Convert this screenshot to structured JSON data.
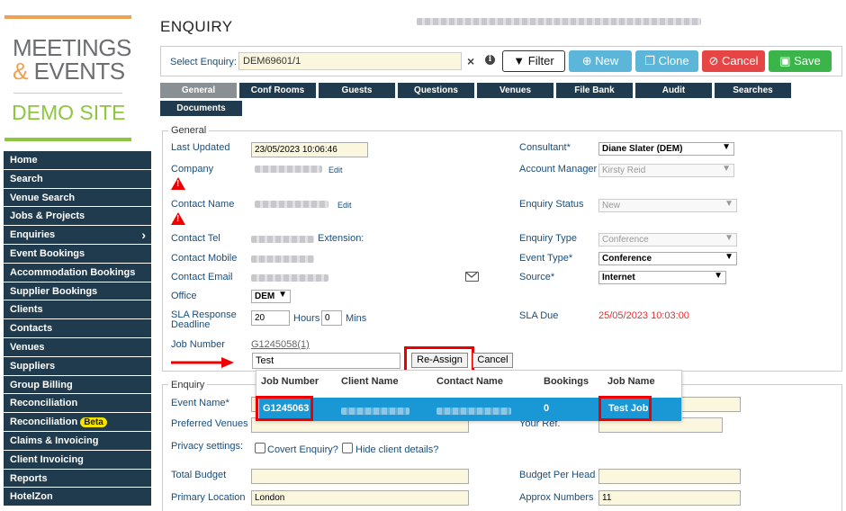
{
  "logo": {
    "line1": "MEETINGS",
    "amp": "&",
    "line2": "EVENTS",
    "demo": "DEMO SITE"
  },
  "sidebar": {
    "items": [
      {
        "label": "Home"
      },
      {
        "label": "Search"
      },
      {
        "label": "Venue Search"
      },
      {
        "label": "Jobs & Projects"
      },
      {
        "label": "Enquiries"
      },
      {
        "label": "Event Bookings"
      },
      {
        "label": "Accommodation Bookings"
      },
      {
        "label": "Supplier Bookings"
      },
      {
        "label": "Clients"
      },
      {
        "label": "Contacts"
      },
      {
        "label": "Venues"
      },
      {
        "label": "Suppliers"
      },
      {
        "label": "Group Billing"
      },
      {
        "label": "Reconciliation"
      },
      {
        "label": "Reconciliation",
        "badge": "Beta"
      },
      {
        "label": "Claims & Invoicing"
      },
      {
        "label": "Client Invoicing"
      },
      {
        "label": "Reports"
      },
      {
        "label": "HotelZon"
      }
    ]
  },
  "page": {
    "title": "ENQUIRY"
  },
  "select_bar": {
    "label": "Select Enquiry:",
    "value": "DEM69601/1",
    "clear": "×",
    "info": "i"
  },
  "buttons": {
    "filter": "Filter",
    "new": "New",
    "clone": "Clone",
    "cancel": "Cancel",
    "save": "Save"
  },
  "tabs": [
    "General",
    "Conf Rooms",
    "Guests",
    "Questions",
    "Venues",
    "File Bank",
    "Audit",
    "Searches",
    "Documents"
  ],
  "general": {
    "legend": "General",
    "last_updated_label": "Last Updated",
    "last_updated": "23/05/2023 10:06:46",
    "company_label": "Company",
    "edit": "Edit",
    "contact_name_label": "Contact Name",
    "contact_tel_label": "Contact Tel",
    "extension_label": "Extension:",
    "contact_mobile_label": "Contact Mobile",
    "contact_email_label": "Contact Email",
    "office_label": "Office",
    "office": "DEM",
    "sla_label_1": "SLA Response",
    "sla_label_2": "Deadline",
    "sla_hours": "20",
    "hours_label": "Hours",
    "sla_mins": "0",
    "mins_label": "Mins",
    "job_number_label": "Job Number",
    "job_number_link": "G1245058(1)",
    "job_search": "Test",
    "reassign": "Re-Assign",
    "cancel": "Cancel",
    "consultant_label": "Consultant*",
    "consultant": "Diane Slater (DEM)",
    "account_manager_label": "Account Manager",
    "account_manager": "Kirsty Reid",
    "enquiry_status_label": "Enquiry Status",
    "enquiry_status": "New",
    "enquiry_type_label": "Enquiry Type",
    "enquiry_type": "Conference",
    "event_type_label": "Event Type*",
    "event_type": "Conference",
    "source_label": "Source*",
    "source": "Internet",
    "sla_due_label": "SLA Due",
    "sla_due": "25/05/2023 10:03:00"
  },
  "popup": {
    "headers": [
      "Job Number",
      "Client Name",
      "Contact Name",
      "Bookings",
      "Job Name"
    ],
    "row": {
      "job_number": "G1245063",
      "bookings": "0",
      "job_name": "Test Job"
    }
  },
  "enquiry": {
    "legend": "Enquiry",
    "event_name_label": "Event Name*",
    "preferred_venues_label": "Preferred Venues",
    "your_ref_label": "Your Ref.",
    "privacy_label": "Privacy settings:",
    "covert_label": "Covert Enquiry?",
    "hide_label": "Hide client details?",
    "total_budget_label": "Total Budget",
    "budget_pp_label": "Budget Per Head",
    "primary_location_label": "Primary Location",
    "primary_location": "London",
    "approx_numbers_label": "Approx Numbers",
    "approx_numbers": "11"
  },
  "colors": {
    "sidebar": "#1f3b4d",
    "new": "#5bb6d9",
    "clone": "#5bb6d9",
    "cancel": "#e54545",
    "save": "#3bb54a",
    "highlight": "#1a98d5",
    "annotation": "#e00000",
    "sla_due": "#e03030"
  }
}
